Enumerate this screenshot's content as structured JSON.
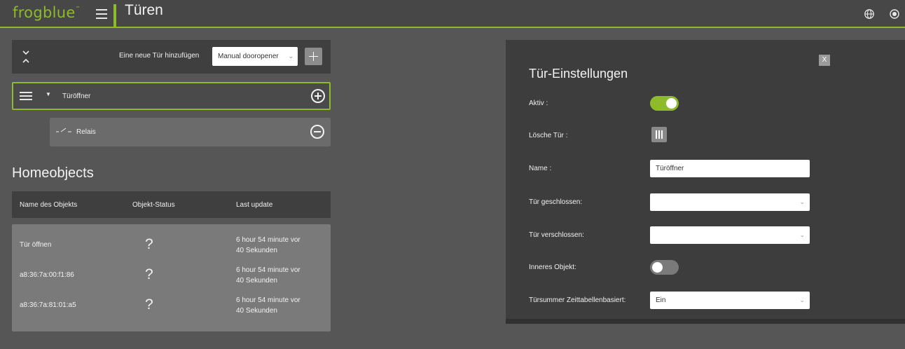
{
  "topbar": {
    "logo": "frogblue",
    "logo_tm": "™",
    "page_title": "Türen",
    "icons": [
      "menu-icon",
      "globe-icon",
      "power-icon"
    ]
  },
  "add_panel": {
    "label": "Eine neue Tür hinzufügen",
    "select_value": "Manual dooropener",
    "icons": [
      "collapse-icon",
      "plus-icon",
      "chevron-down-icon"
    ]
  },
  "doors": [
    {
      "label": "Türöffner",
      "icons": [
        "drag-handle-icon",
        "caret-down-icon",
        "add-circle-icon"
      ],
      "children": [
        {
          "label": "Relais",
          "icons": [
            "relay-icon",
            "remove-circle-icon"
          ]
        }
      ]
    }
  ],
  "homeobjects": {
    "title": "Homeobjects",
    "columns": [
      "Name des Objekts",
      "Objekt-Status",
      "Last update"
    ],
    "rows": [
      {
        "name": "Tür öffnen",
        "status": "?",
        "time_line1": "6 hour 54 minute vor",
        "time_line2": "40 Sekunden"
      },
      {
        "name": "a8:36:7a:00:f1:86",
        "status": "?",
        "time_line1": "6 hour 54 minute vor",
        "time_line2": "40 Sekunden"
      },
      {
        "name": "a8:36:7a:81:01:a5",
        "status": "?",
        "time_line1": "6 hour 54 minute vor",
        "time_line2": "40 Sekunden"
      }
    ]
  },
  "settings": {
    "title": "Tür-Einstellungen",
    "close_label": "X",
    "aktiv_label": "Aktiv :",
    "aktiv_on": true,
    "loesche_label": "Lösche Tür :",
    "name_label": "Name :",
    "name_value": "Türöffner",
    "geschlossen_label": "Tür geschlossen:",
    "geschlossen_value": "",
    "verschlossen_label": "Tür verschlossen:",
    "verschlossen_value": "",
    "inneres_label": "Inneres Objekt:",
    "inneres_on": false,
    "summer_label": "Türsummer Zeittabellenbasiert:",
    "summer_value": "Ein",
    "icons": [
      "close-icon",
      "trash-icon",
      "chevron-down-icon"
    ]
  },
  "colors": {
    "accent": "#8dbb2a",
    "topbar_bg": "#474747",
    "page_bg": "#565656",
    "panel_bg": "#3d3d3d"
  }
}
